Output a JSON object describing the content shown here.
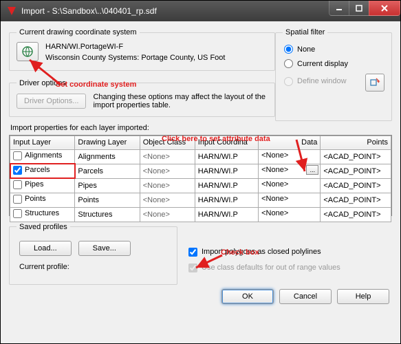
{
  "window": {
    "title": "Import - S:\\Sandbox\\..\\040401_rp.sdf"
  },
  "coord": {
    "legend": "Current drawing coordinate system",
    "line1": "HARN/WI.PortageWI-F",
    "line2": "Wisconsin County Systems: Portage County, US Foot"
  },
  "driver": {
    "legend": "Driver options",
    "button": "Driver Options...",
    "note": "Changing these options may affect the layout of the import properties table."
  },
  "spatial": {
    "legend": "Spatial filter",
    "opt1": "None",
    "opt2": "Current display",
    "opt3": "Define window"
  },
  "table": {
    "caption": "Import properties for each layer imported:",
    "headers": {
      "c1": "Input Layer",
      "c2": "Drawing Layer",
      "c3": "Object Class",
      "c4": "Input Coordina",
      "c5": "Data",
      "c6": "Points"
    },
    "rows": [
      {
        "checked": false,
        "input": "Alignments",
        "drawing": "Alignments",
        "oclass": "<None>",
        "coord": "HARN/WI.P",
        "data": "<None>",
        "points": "<ACAD_POINT>",
        "highlight": false,
        "dataBtn": false
      },
      {
        "checked": true,
        "input": "Parcels",
        "drawing": "Parcels",
        "oclass": "<None>",
        "coord": "HARN/WI.P",
        "data": "<None>",
        "points": "<ACAD_POINT>",
        "highlight": true,
        "dataBtn": true
      },
      {
        "checked": false,
        "input": "Pipes",
        "drawing": "Pipes",
        "oclass": "<None>",
        "coord": "HARN/WI.P",
        "data": "<None>",
        "points": "<ACAD_POINT>",
        "highlight": false,
        "dataBtn": false
      },
      {
        "checked": false,
        "input": "Points",
        "drawing": "Points",
        "oclass": "<None>",
        "coord": "HARN/WI.P",
        "data": "<None>",
        "points": "<ACAD_POINT>",
        "highlight": false,
        "dataBtn": false
      },
      {
        "checked": false,
        "input": "Structures",
        "drawing": "Structures",
        "oclass": "<None>",
        "coord": "HARN/WI.P",
        "data": "<None>",
        "points": "<ACAD_POINT>",
        "highlight": false,
        "dataBtn": false
      }
    ]
  },
  "saved": {
    "legend": "Saved profiles",
    "load": "Load...",
    "save": "Save...",
    "current_label": "Current profile:"
  },
  "checks": {
    "closed": "Import polygons as closed polylines",
    "defaults": "Use class defaults for out of range values"
  },
  "buttons": {
    "ok": "OK",
    "cancel": "Cancel",
    "help": "Help"
  },
  "annot": {
    "coord": "Set coordinate system",
    "data": "Click here to set attribute data",
    "check": "Check box"
  }
}
